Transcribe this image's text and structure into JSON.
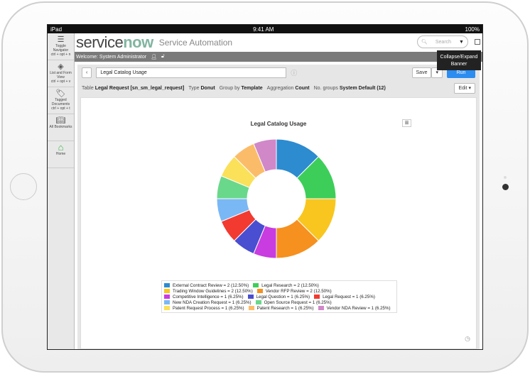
{
  "status": {
    "device": "iPad",
    "time": "9:41 AM",
    "battery": "100%"
  },
  "sidebar": [
    {
      "label": "Toggle Navigator",
      "shortcut": "ctrl + opt + n",
      "icon": "list-icon"
    },
    {
      "label": "List and Form View",
      "shortcut": "ctrl + opt + v",
      "icon": "split-view-icon"
    },
    {
      "label": "Tagged Documents",
      "shortcut": "ctrl + opt + t",
      "icon": "tag-icon"
    },
    {
      "label": "All Bookmarks",
      "shortcut": "",
      "icon": "book-icon"
    },
    {
      "label": "Home",
      "shortcut": "",
      "icon": "home-icon"
    }
  ],
  "banner": {
    "logo_a": "service",
    "logo_b": "now",
    "subtitle": "Service Automation",
    "search_placeholder": "Search",
    "welcome": "Welcome: System Administrator",
    "tooltip": "Collapse/Expand Banner"
  },
  "toolbar": {
    "report_name": "Legal Catalog Usage",
    "save": "Save",
    "run": "Run",
    "edit": "Edit"
  },
  "meta": [
    {
      "k": "Table",
      "v": "Legal Request [sn_sm_legal_request]"
    },
    {
      "k": "Type",
      "v": "Donut"
    },
    {
      "k": "Group by",
      "v": "Template"
    },
    {
      "k": "Aggregation",
      "v": "Count"
    },
    {
      "k": "No. groups",
      "v": "System Default (12)"
    }
  ],
  "chart_data": {
    "type": "pie",
    "title": "Legal Catalog Usage",
    "donut": true,
    "slices": [
      {
        "name": "External Contract Review",
        "value": 2,
        "pct": "12.50%",
        "color": "#2d8bd0"
      },
      {
        "name": "Legal Research",
        "value": 2,
        "pct": "12.50%",
        "color": "#3dce5a"
      },
      {
        "name": "Trading Window Guidelines",
        "value": 2,
        "pct": "12.50%",
        "color": "#f8c61e"
      },
      {
        "name": "Vendor RFP Review",
        "value": 2,
        "pct": "12.50%",
        "color": "#f6901e"
      },
      {
        "name": "Competitive Intelligence",
        "value": 1,
        "pct": "6.25%",
        "color": "#c83ce0"
      },
      {
        "name": "Legal Question",
        "value": 1,
        "pct": "6.25%",
        "color": "#4a4ed0"
      },
      {
        "name": "Legal Request",
        "value": 1,
        "pct": "6.25%",
        "color": "#f23a30"
      },
      {
        "name": "New NDA Creation Request",
        "value": 1,
        "pct": "6.25%",
        "color": "#7ab8f5"
      },
      {
        "name": "Open Source Request",
        "value": 1,
        "pct": "6.25%",
        "color": "#6ad88a"
      },
      {
        "name": "Patent Request Process",
        "value": 1,
        "pct": "6.25%",
        "color": "#fbe05a"
      },
      {
        "name": "Patent Research",
        "value": 1,
        "pct": "6.25%",
        "color": "#fbbc6a"
      },
      {
        "name": "Vendor NDA Review",
        "value": 1,
        "pct": "6.25%",
        "color": "#d088c8"
      }
    ],
    "legend_rows": [
      [
        0,
        1
      ],
      [
        2,
        3
      ],
      [
        4,
        5,
        6
      ],
      [
        7,
        8
      ],
      [
        9,
        10,
        11
      ]
    ]
  }
}
